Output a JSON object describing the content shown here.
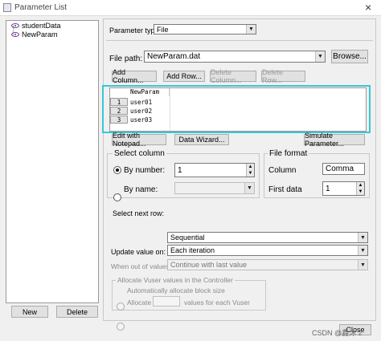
{
  "window": {
    "title": "Parameter List",
    "close_glyph": "×"
  },
  "tree": {
    "items": [
      "studentData",
      "NewParam"
    ]
  },
  "left_buttons": {
    "new": "New",
    "delete": "Delete"
  },
  "parameter_type": {
    "label": "Parameter type:",
    "value": "File"
  },
  "file_path": {
    "label": "File path:",
    "value": "NewParam.dat",
    "browse": "Browse..."
  },
  "table_buttons": {
    "add_column": "Add Column...",
    "add_row": "Add Row...",
    "delete_column": "Delete Column...",
    "delete_row": "Delete Row..."
  },
  "grid": {
    "header": "NewParam",
    "rows": [
      {
        "num": "1",
        "value": "user01"
      },
      {
        "num": "2",
        "value": "user02"
      },
      {
        "num": "3",
        "value": "user03"
      }
    ]
  },
  "tools": {
    "edit_notepad": "Edit with Notepad...",
    "data_wizard": "Data Wizard...",
    "simulate": "Simulate Parameter..."
  },
  "select_column": {
    "title": "Select column",
    "by_number": "By number:",
    "number_value": "1",
    "by_name": "By name:"
  },
  "file_format": {
    "title": "File format",
    "column_label": "Column",
    "column_value": "Comma",
    "first_data_label": "First data",
    "first_data_value": "1"
  },
  "select_next_row": {
    "label": "Select next row:",
    "value": "Sequential"
  },
  "update_value": {
    "label": "Update value on:",
    "value": "Each iteration"
  },
  "when_out": {
    "label": "When out of values:",
    "value": "Continue with last value"
  },
  "allocate": {
    "title": "Allocate Vuser values in the Controller",
    "auto": "Automatically allocate block size",
    "allocate": "Allocate",
    "suffix": "values for each Vuser"
  },
  "footer": {
    "close": "Close",
    "watermark": "CSDN @鑫沐 2"
  }
}
